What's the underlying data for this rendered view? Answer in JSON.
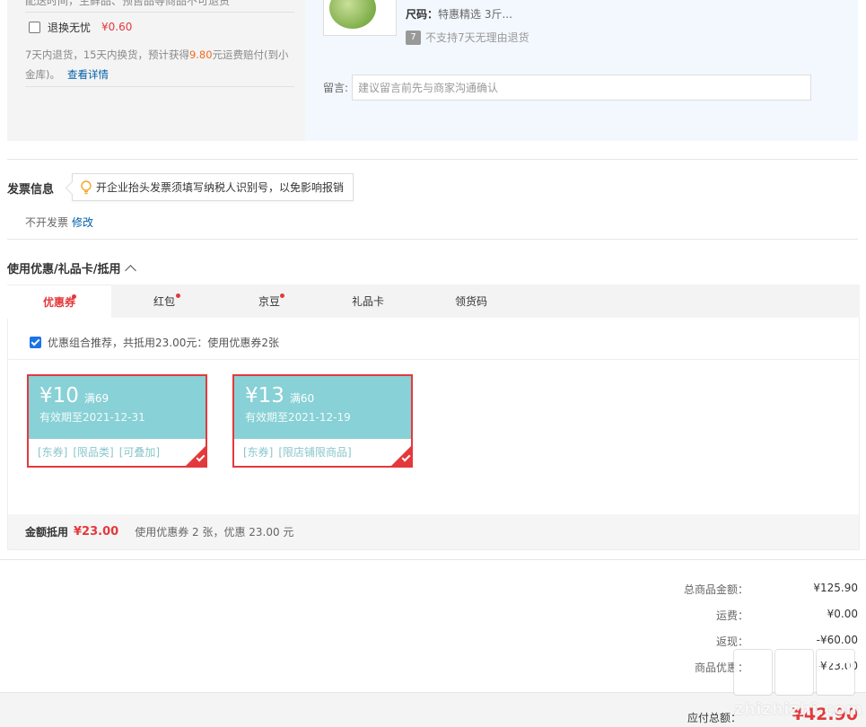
{
  "service": {
    "cut_text": "配送时间，生鲜品、预售品等商品不可退货",
    "name": "退换无忧",
    "price": "¥0.60",
    "desc_part1": "7天内退货，15天内换货，预计获得",
    "desc_amount": "9.80",
    "desc_part2": "元运费赔付(到小金库)。",
    "detail_link": "查看详情"
  },
  "product": {
    "spec_label": "尺码：",
    "spec_value": "特惠精选 3斤...",
    "noreturn_badge": "7",
    "noreturn_text": "不支持7天无理由退货",
    "remark_label": "留言:",
    "remark_placeholder": "建议留言前先与商家沟通确认"
  },
  "invoice": {
    "title": "发票信息",
    "tip": "开企业抬头发票须填写纳税人识别号，以免影响报销",
    "status": "不开发票",
    "edit_link": "修改"
  },
  "coupons": {
    "title": "使用优惠/礼品卡/抵用",
    "tabs": [
      {
        "label": "优惠券"
      },
      {
        "label": "红包"
      },
      {
        "label": "京豆"
      },
      {
        "label": "礼品卡"
      },
      {
        "label": "领货码"
      }
    ],
    "combo_text": "优惠组合推荐，共抵用23.00元：使用优惠券2张",
    "items": [
      {
        "amount": "¥10",
        "condition": "满69",
        "valid": "有效期至2021-12-31",
        "tags": [
          "[东券]",
          "[限品类]",
          "[可叠加]"
        ]
      },
      {
        "amount": "¥13",
        "condition": "满60",
        "valid": "有效期至2021-12-19",
        "tags": [
          "[东券]",
          "[限店铺限商品]"
        ]
      }
    ],
    "summary_label": "金额抵用",
    "summary_amount": "¥23.00",
    "summary_desc": "使用优惠券 2 张，优惠 23.00 元"
  },
  "totals": {
    "goods_label": "总商品金额：",
    "goods_value": "¥125.90",
    "shipping_label": "运费：",
    "shipping_value": "¥0.00",
    "cashback_label": "返现：",
    "cashback_value": "-¥60.00",
    "discount_label": "商品优惠：",
    "discount_value": "-¥23.00",
    "payable_label": "应付总额：",
    "payable_value": "¥42.90"
  },
  "watermark": "zhizhizhi.com",
  "colors": {
    "accent": "#e4393c",
    "coupon": "#88d1d6",
    "link": "#005ea7",
    "orange": "#f26b1d"
  }
}
